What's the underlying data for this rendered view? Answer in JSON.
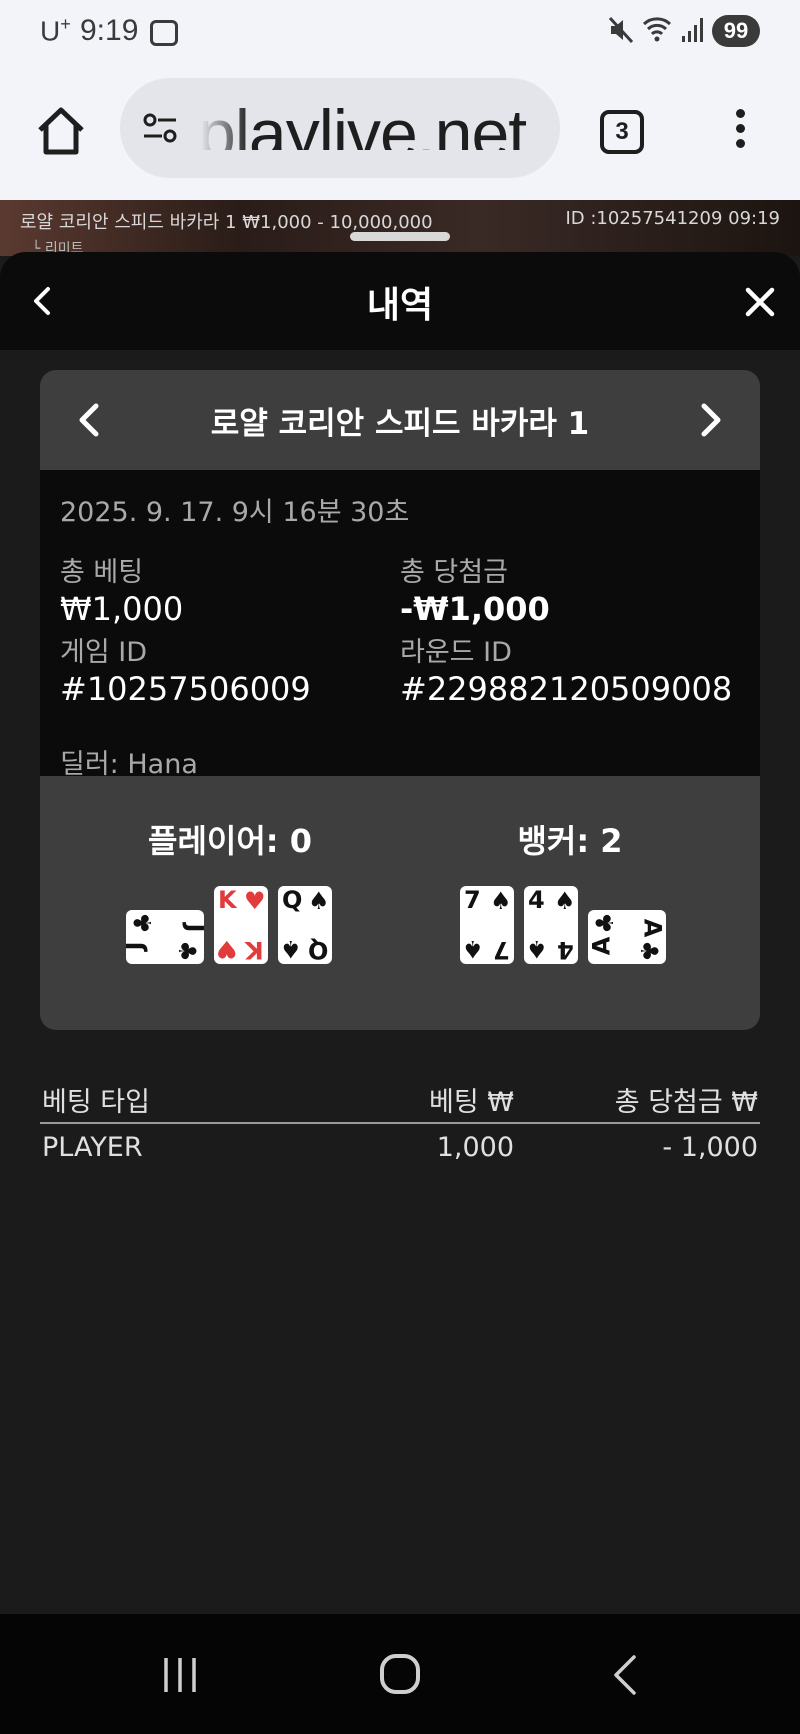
{
  "status_bar": {
    "carrier": "U",
    "carrier_sup": "+",
    "time": "9:19",
    "battery": "99"
  },
  "browser": {
    "url": "playlive.net",
    "tab_count": "3"
  },
  "game_bar": {
    "title": "로얄 코리안 스피드 바카라 1 ₩1,000 - 10,000,000",
    "id_time": "ID :10257541209 09:19",
    "sub": "└ 리미트"
  },
  "modal": {
    "title": "내역"
  },
  "game_card": {
    "name": "로얄 코리안 스피드 바카라 1",
    "date": "2025. 9. 17. 9시 16분 30초",
    "total_bet_label": "총 베팅",
    "total_bet_value": "₩1,000",
    "total_win_label": "총 당첨금",
    "total_win_value": "-₩1,000",
    "game_id_label": "게임 ID",
    "game_id_value": "#10257506009",
    "round_id_label": "라운드 ID",
    "round_id_value": "#229882120509008",
    "dealer": "딜러: Hana"
  },
  "hands": {
    "player_title": "플레이어: 0",
    "banker_title": "뱅커: 2",
    "player_cards": [
      {
        "rank": "J",
        "suit": "♣",
        "color": "#111111",
        "sideways": true
      },
      {
        "rank": "K",
        "suit": "♥",
        "color": "#e23b3b",
        "sideways": false
      },
      {
        "rank": "Q",
        "suit": "♠",
        "color": "#111111",
        "sideways": false
      }
    ],
    "banker_cards": [
      {
        "rank": "7",
        "suit": "♠",
        "color": "#111111",
        "sideways": false
      },
      {
        "rank": "4",
        "suit": "♠",
        "color": "#111111",
        "sideways": false
      },
      {
        "rank": "A",
        "suit": "♣",
        "color": "#111111",
        "sideways": true
      }
    ]
  },
  "bets_table": {
    "headers": [
      "베팅 타입",
      "베팅 ₩",
      "총 당첨금 ₩"
    ],
    "rows": [
      [
        "PLAYER",
        "1,000",
        "- 1,000"
      ]
    ]
  }
}
